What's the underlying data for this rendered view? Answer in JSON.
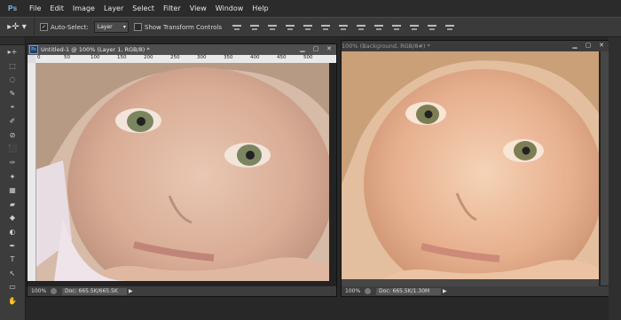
{
  "app": {
    "logo": "Ps"
  },
  "menu": [
    "File",
    "Edit",
    "Image",
    "Layer",
    "Select",
    "Filter",
    "View",
    "Window",
    "Help"
  ],
  "options": {
    "move_icon": "move-tool-icon",
    "auto_select_label": "Auto-Select:",
    "auto_select_checked": true,
    "auto_select_target": "Layer",
    "show_transform_label": "Show Transform Controls",
    "show_transform_checked": false
  },
  "tools": [
    "▸+",
    "⬚",
    "◌",
    "✎",
    "⌖",
    "✐",
    "⊘",
    "⬛",
    "✑",
    "✦",
    "▦",
    "▰",
    "◆",
    "◐",
    "✒",
    "T",
    "↖",
    "▭",
    "✋"
  ],
  "doc_left": {
    "title": "Untitled-1 @ 100% (Layer 1, RGB/8) *",
    "ruler_marks": [
      "0",
      "50",
      "100",
      "150",
      "200",
      "250",
      "300",
      "350",
      "400",
      "450",
      "500"
    ],
    "zoom": "100%",
    "doc_size": "Doc: 665.5K/665.5K"
  },
  "doc_right": {
    "title": "100% (Background, RGB/8#) *",
    "zoom": "100%",
    "doc_size": "Doc: 665.5K/1.30M"
  },
  "window_buttons": {
    "minimize": "▁",
    "maximize": "▢",
    "close": "✕"
  },
  "colors": {
    "accent": "#6fa8dc",
    "panel": "#3c3c3c",
    "workspace": "#282828"
  }
}
